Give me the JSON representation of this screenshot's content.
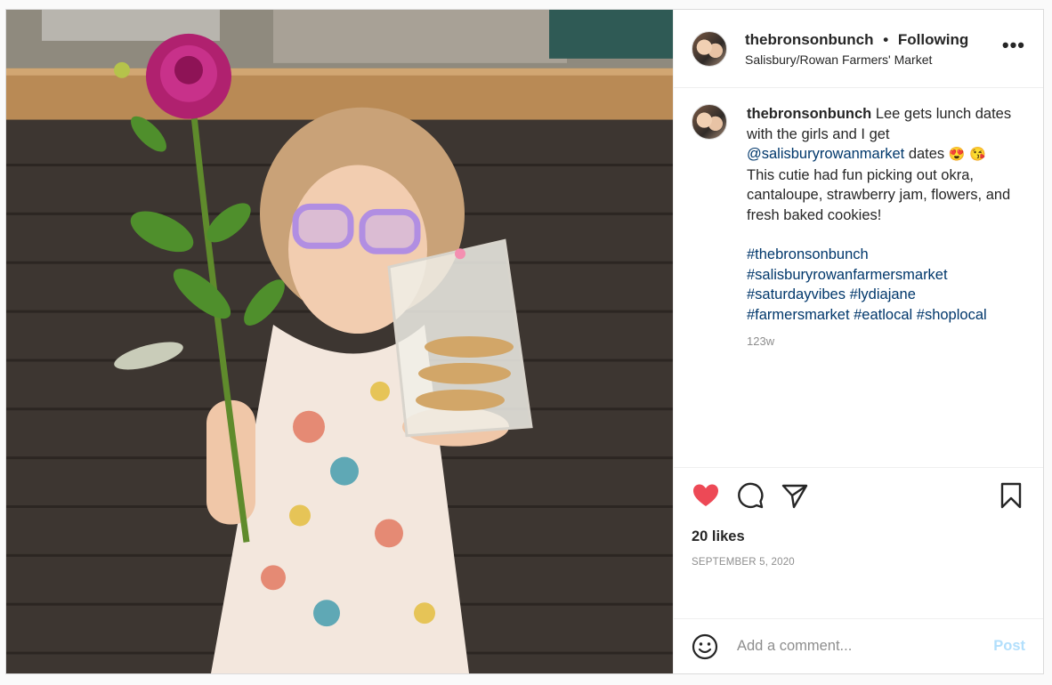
{
  "header": {
    "username": "thebronsonbunch",
    "separator": "•",
    "follow_status": "Following",
    "location": "Salisbury/Rowan Farmers' Market",
    "more_label": "•••"
  },
  "caption": {
    "username": "thebronsonbunch",
    "text_before_mention": " Lee gets lunch dates with the girls and I get ",
    "mention": "@salisburyrowanmarket",
    "text_after_mention": " dates ",
    "emoji_1": "😍",
    "emoji_2": "😘",
    "text_body": "This cutie had fun picking out okra, cantaloupe, strawberry jam, flowers, and fresh baked cookies!",
    "hashtags": [
      "#thebronsonbunch",
      "#salisburyrowanfarmersmarket",
      "#saturdayvibes",
      "#lydiajane",
      "#farmersmarket",
      "#eatlocal",
      "#shoplocal"
    ],
    "time_ago": "123w"
  },
  "actions": {
    "like_icon": "heart-filled-icon",
    "comment_icon": "comment-icon",
    "share_icon": "share-icon",
    "save_icon": "bookmark-icon",
    "like_color": "#ed4956"
  },
  "likes_label": "20 likes",
  "date_label": "SEPTEMBER 5, 2020",
  "comment_box": {
    "placeholder": "Add a comment...",
    "post_label": "Post",
    "post_color": "#b2dffc"
  }
}
